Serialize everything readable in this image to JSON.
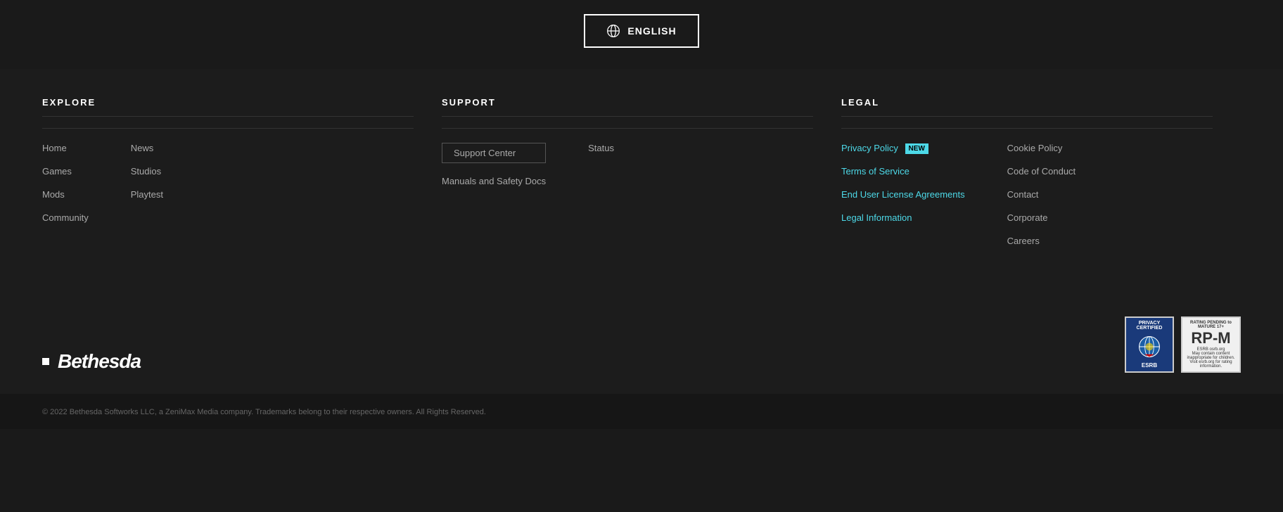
{
  "topbar": {
    "language_btn": "ENGLISH"
  },
  "explore": {
    "title": "EXPLORE",
    "col1": [
      {
        "label": "Home"
      },
      {
        "label": "Games"
      },
      {
        "label": "Mods"
      },
      {
        "label": "Community"
      }
    ],
    "col2": [
      {
        "label": "News"
      },
      {
        "label": "Studios"
      },
      {
        "label": "Playtest"
      }
    ]
  },
  "support": {
    "title": "SUPPORT",
    "col1": [
      {
        "label": "Support Center",
        "highlighted": true
      },
      {
        "label": "Manuals and Safety Docs"
      }
    ],
    "col2": [
      {
        "label": "Status"
      }
    ]
  },
  "legal": {
    "title": "LEGAL",
    "col1": [
      {
        "label": "Privacy Policy",
        "badge": "NEW"
      },
      {
        "label": "Terms of Service"
      },
      {
        "label": "End User License Agreements"
      },
      {
        "label": "Legal Information"
      }
    ],
    "col2": [
      {
        "label": "Cookie Policy"
      },
      {
        "label": "Code of Conduct"
      },
      {
        "label": "Contact"
      },
      {
        "label": "Corporate"
      },
      {
        "label": "Careers"
      }
    ]
  },
  "footer": {
    "logo": "Bethesda",
    "copyright": "© 2022 Bethesda Softworks LLC, a ZeniMax Media company. Trademarks belong to their respective owners. All Rights Reserved."
  }
}
